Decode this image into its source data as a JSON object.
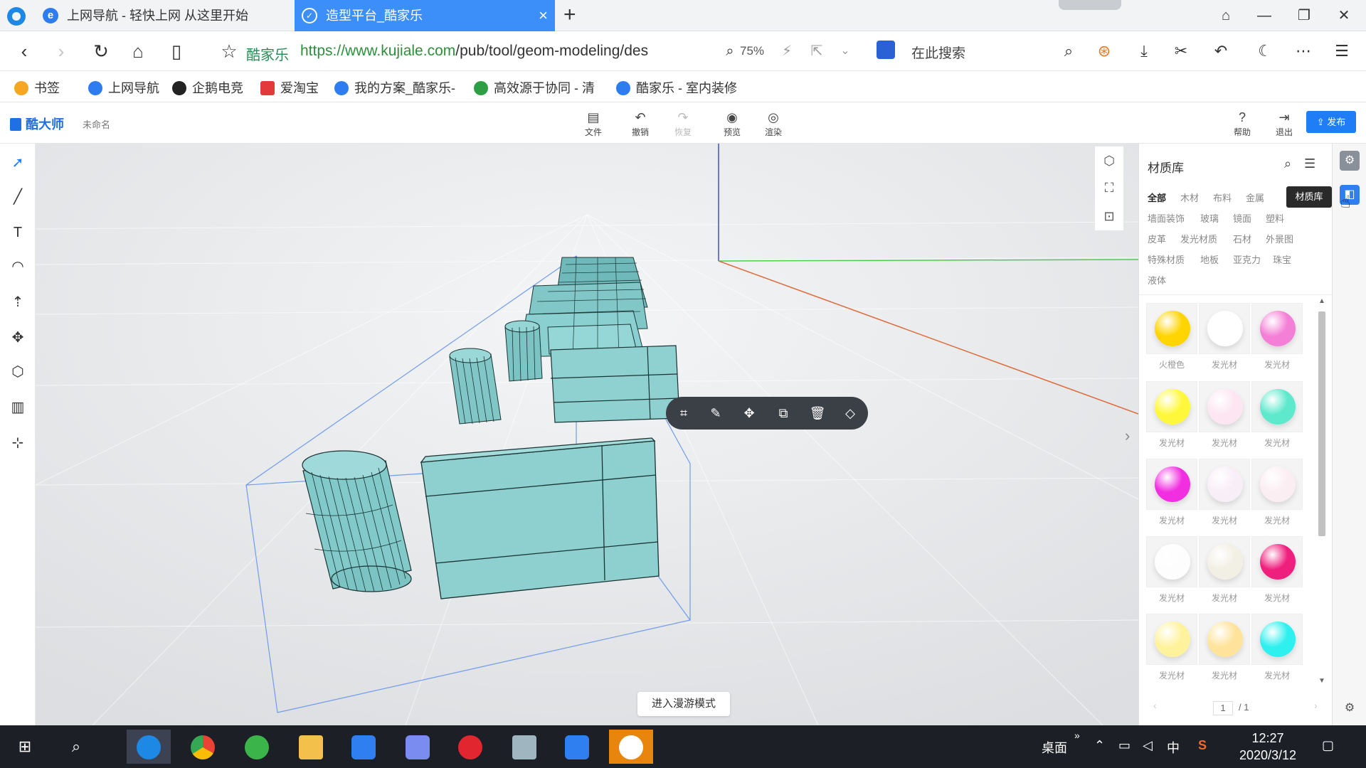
{
  "browser": {
    "tabs": [
      {
        "label": "上网导航 - 轻快上网 从这里开始",
        "active": false
      },
      {
        "label": "造型平台_酷家乐",
        "active": true
      }
    ],
    "address": {
      "site_name": "酷家乐",
      "url_scheme_host": "https://www.kujiale.com",
      "url_path": "/pub/tool/geom-modeling/des",
      "zoom": "75%",
      "search_placeholder": "在此搜索"
    },
    "bookmarks": [
      {
        "label": "书签",
        "color": "#f5a623"
      },
      {
        "label": "上网导航",
        "color": "#2d7cf0"
      },
      {
        "label": "企鹅电竞",
        "color": "#222222"
      },
      {
        "label": "爱淘宝",
        "color": "#e4393c"
      },
      {
        "label": "我的方案_酷家乐-",
        "color": "#2d7cf0"
      },
      {
        "label": "高效源于协同 - 清",
        "color": "#2e9e44"
      },
      {
        "label": "酷家乐 - 室内装修",
        "color": "#2d7cf0"
      }
    ]
  },
  "app": {
    "brand": "酷大师",
    "doc_name": "未命名",
    "toolbar": [
      {
        "label": "文件",
        "icon": "file-icon",
        "glyph": "▤",
        "enabled": true
      },
      {
        "label": "撤销",
        "icon": "undo-icon",
        "glyph": "↶",
        "enabled": true
      },
      {
        "label": "恢复",
        "icon": "redo-icon",
        "glyph": "↷",
        "enabled": false
      },
      {
        "label": "预览",
        "icon": "camera-icon",
        "glyph": "◉",
        "enabled": true
      },
      {
        "label": "渲染",
        "icon": "render-icon",
        "glyph": "◎",
        "enabled": true
      }
    ],
    "right_actions": {
      "help": "帮助",
      "exit": "退出",
      "publish": "发布"
    },
    "roam_button": "进入漫游模式"
  },
  "materials": {
    "title": "材质库",
    "tooltip": "材质库",
    "categories": [
      [
        "全部",
        "木材",
        "布料",
        "金属"
      ],
      [
        "墙面装饰",
        "玻璃",
        "镜面",
        "塑料"
      ],
      [
        "皮革",
        "发光材质",
        "石材",
        "外景图"
      ],
      [
        "特殊材质",
        "地板",
        "亚克力",
        "珠宝"
      ],
      [
        "液体"
      ]
    ],
    "active_category": "全部",
    "items": [
      {
        "label": "火橙色",
        "color": "#ffd400"
      },
      {
        "label": "发光材",
        "color": "#ffffff"
      },
      {
        "label": "发光材",
        "color": "#f47fd6"
      },
      {
        "label": "发光材",
        "color": "#fff83a"
      },
      {
        "label": "发光材",
        "color": "#fde6f1"
      },
      {
        "label": "发光材",
        "color": "#5ee9cc"
      },
      {
        "label": "发光材",
        "color": "#f12ee0"
      },
      {
        "label": "发光材",
        "color": "#f8eef7"
      },
      {
        "label": "发光材",
        "color": "#fbeef3"
      },
      {
        "label": "发光材",
        "color": "#fdfdfd"
      },
      {
        "label": "发光材",
        "color": "#f2efe4"
      },
      {
        "label": "发光材",
        "color": "#ef1f7e"
      },
      {
        "label": "发光材",
        "color": "#fff29c"
      },
      {
        "label": "发光材",
        "color": "#ffe39a"
      },
      {
        "label": "发光材",
        "color": "#2ef0ee"
      }
    ],
    "page_current": "1",
    "page_total": "/ 1"
  },
  "taskbar": {
    "tray_desktop": "桌面",
    "ime": "中",
    "time": "12:27",
    "date": "2020/3/12"
  },
  "colors": {
    "accent": "#1f7ef5",
    "active_tab": "#3c8ff8",
    "model": "#8ecfcf"
  }
}
